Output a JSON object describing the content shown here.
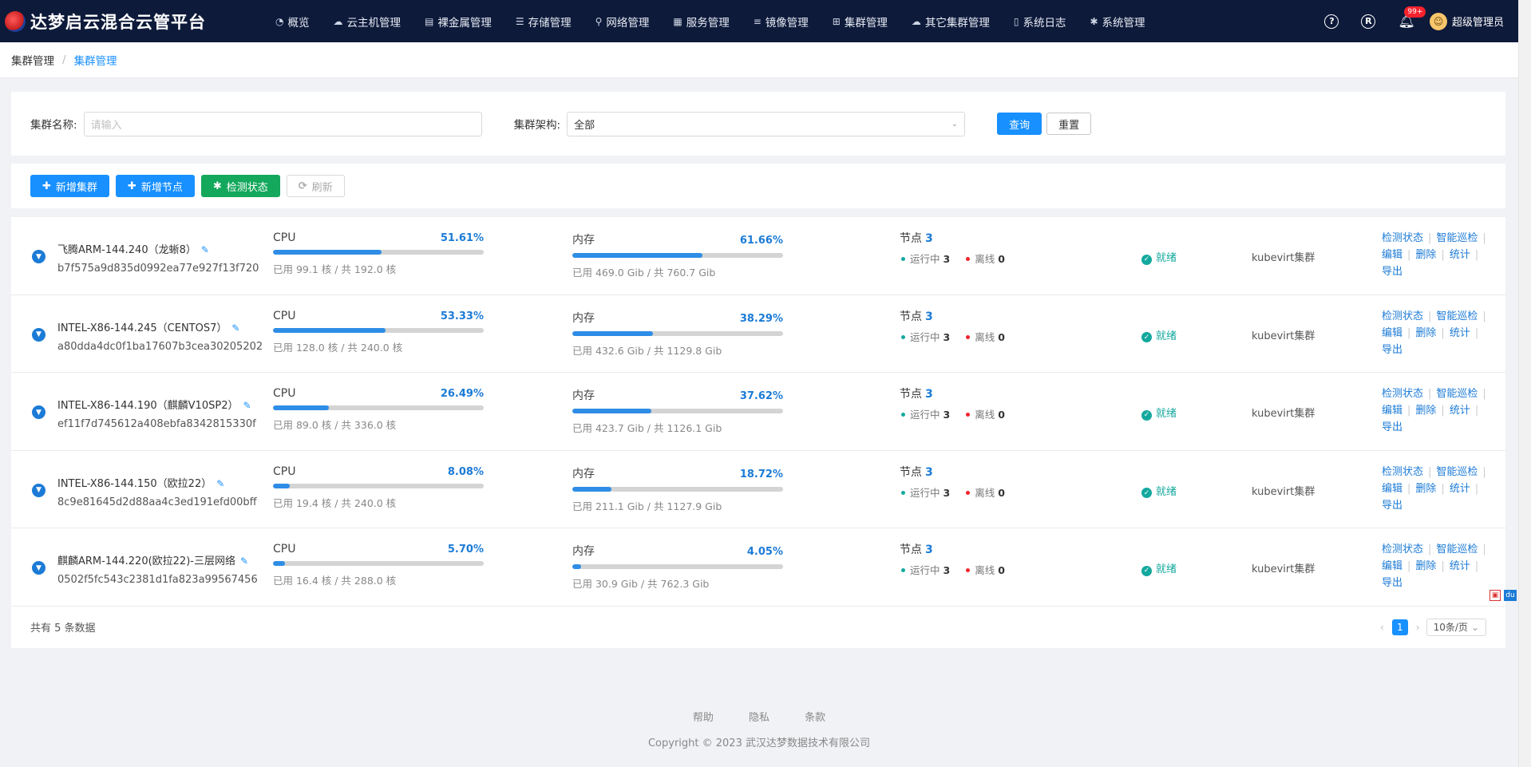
{
  "brand": {
    "name": "达梦启云混合云管平台"
  },
  "nav": [
    {
      "icon": "◔",
      "label": "概览"
    },
    {
      "icon": "☁",
      "label": "云主机管理"
    },
    {
      "icon": "▤",
      "label": "裸金属管理"
    },
    {
      "icon": "☰",
      "label": "存储管理"
    },
    {
      "icon": "⚲",
      "label": "网络管理"
    },
    {
      "icon": "▦",
      "label": "服务管理"
    },
    {
      "icon": "≡",
      "label": "镜像管理"
    },
    {
      "icon": "⊞",
      "label": "集群管理"
    },
    {
      "icon": "☁",
      "label": "其它集群管理"
    },
    {
      "icon": "▯",
      "label": "系统日志"
    },
    {
      "icon": "✱",
      "label": "系统管理"
    }
  ],
  "topright": {
    "help": "?",
    "registered": "R",
    "badge": "99+",
    "username": "超级管理员"
  },
  "breadcrumb": {
    "parent": "集群管理",
    "sep": "/",
    "current": "集群管理"
  },
  "filter": {
    "name_label": "集群名称:",
    "name_placeholder": "请输入",
    "arch_label": "集群架构:",
    "arch_value": "全部",
    "query": "查询",
    "reset": "重置"
  },
  "toolbar": {
    "add_cluster": "新增集群",
    "add_node": "新增节点",
    "check_status": "检测状态",
    "refresh": "刷新"
  },
  "labels": {
    "cpu": "CPU",
    "mem": "内存",
    "nodes": "节点",
    "running": "运行中",
    "offline": "离线",
    "op_check": "检测状态",
    "op_patrol": "智能巡检",
    "op_edit": "编辑",
    "op_delete": "删除",
    "op_stats": "统计",
    "op_export": "导出"
  },
  "clusters": [
    {
      "name": "飞腾ARM-144.240（龙蜥8）",
      "id": "b7f575a9d835d0992ea77e927f13f720",
      "cpu_pct": "51.61%",
      "cpu_frac": 0.5161,
      "cpu_used": "已用 99.1 核 / 共 192.0 核",
      "mem_pct": "61.66%",
      "mem_frac": 0.6166,
      "mem_used": "已用 469.0 Gib / 共 760.7 Gib",
      "nodes": "3",
      "running": "3",
      "offline": "0",
      "status": "就绪",
      "type": "kubevirt集群"
    },
    {
      "name": "INTEL-X86-144.245（CENTOS7）",
      "id": "a80dda4dc0f1ba17607b3cea30205202",
      "cpu_pct": "53.33%",
      "cpu_frac": 0.5333,
      "cpu_used": "已用 128.0 核 / 共 240.0 核",
      "mem_pct": "38.29%",
      "mem_frac": 0.3829,
      "mem_used": "已用 432.6 Gib / 共 1129.8 Gib",
      "nodes": "3",
      "running": "3",
      "offline": "0",
      "status": "就绪",
      "type": "kubevirt集群"
    },
    {
      "name": "INTEL-X86-144.190（麒麟V10SP2）",
      "id": "ef11f7d745612a408ebfa8342815330f",
      "cpu_pct": "26.49%",
      "cpu_frac": 0.2649,
      "cpu_used": "已用 89.0 核 / 共 336.0 核",
      "mem_pct": "37.62%",
      "mem_frac": 0.3762,
      "mem_used": "已用 423.7 Gib / 共 1126.1 Gib",
      "nodes": "3",
      "running": "3",
      "offline": "0",
      "status": "就绪",
      "type": "kubevirt集群"
    },
    {
      "name": "INTEL-X86-144.150（欧拉22）",
      "id": "8c9e81645d2d88aa4c3ed191efd00bff",
      "cpu_pct": "8.08%",
      "cpu_frac": 0.0808,
      "cpu_used": "已用 19.4 核 / 共 240.0 核",
      "mem_pct": "18.72%",
      "mem_frac": 0.1872,
      "mem_used": "已用 211.1 Gib / 共 1127.9 Gib",
      "nodes": "3",
      "running": "3",
      "offline": "0",
      "status": "就绪",
      "type": "kubevirt集群"
    },
    {
      "name": "麒麟ARM-144.220(欧拉22)-三层网络",
      "id": "0502f5fc543c2381d1fa823a99567456",
      "cpu_pct": "5.70%",
      "cpu_frac": 0.057,
      "cpu_used": "已用 16.4 核 / 共 288.0 核",
      "mem_pct": "4.05%",
      "mem_frac": 0.0405,
      "mem_used": "已用 30.9 Gib / 共 762.3 Gib",
      "nodes": "3",
      "running": "3",
      "offline": "0",
      "status": "就绪",
      "type": "kubevirt集群"
    }
  ],
  "pagination": {
    "total": "共有 5 条数据",
    "current": "1",
    "page_size": "10条/页"
  },
  "footer": {
    "help": "帮助",
    "privacy": "隐私",
    "terms": "条款",
    "copyright": "Copyright © 2023 武汉达梦数据技术有限公司"
  }
}
